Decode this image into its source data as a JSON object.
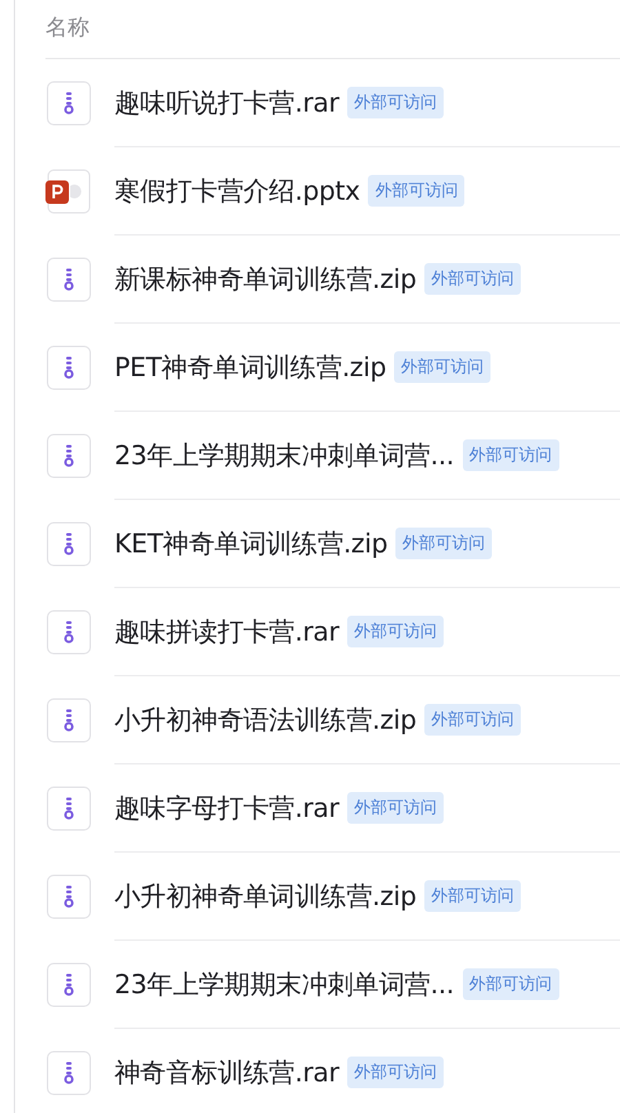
{
  "header": {
    "column_1": "名称"
  },
  "files": [
    {
      "kind": "zip",
      "name": "趣味听说打卡营.rar",
      "badge": "外部可访问"
    },
    {
      "kind": "ppt",
      "name": "寒假打卡营介绍.pptx",
      "badge": "外部可访问"
    },
    {
      "kind": "zip",
      "name": "新课标神奇单词训练营.zip",
      "badge": "外部可访问"
    },
    {
      "kind": "zip",
      "name": "PET神奇单词训练营.zip",
      "badge": "外部可访问"
    },
    {
      "kind": "zip",
      "name": "23年上学期期末冲刺单词营...",
      "badge": "外部可访问"
    },
    {
      "kind": "zip",
      "name": "KET神奇单词训练营.zip",
      "badge": "外部可访问"
    },
    {
      "kind": "zip",
      "name": "趣味拼读打卡营.rar",
      "badge": "外部可访问"
    },
    {
      "kind": "zip",
      "name": "小升初神奇语法训练营.zip",
      "badge": "外部可访问"
    },
    {
      "kind": "zip",
      "name": "趣味字母打卡营.rar",
      "badge": "外部可访问"
    },
    {
      "kind": "zip",
      "name": "小升初神奇单词训练营.zip",
      "badge": "外部可访问"
    },
    {
      "kind": "zip",
      "name": "23年上学期期末冲刺单词营...",
      "badge": "外部可访问"
    },
    {
      "kind": "zip",
      "name": "神奇音标训练营.rar",
      "badge": "外部可访问"
    }
  ]
}
